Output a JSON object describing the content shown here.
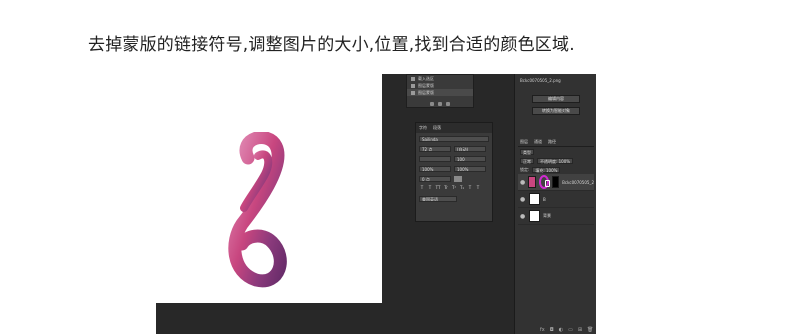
{
  "instruction": "去掉蒙版的链接符号,调整图片的大小,位置,找到合适的颜色区域.",
  "history_panel": {
    "items": [
      "载入选区",
      "图层蒙版",
      "图层蒙版"
    ]
  },
  "character_panel": {
    "tabs": [
      "字符",
      "段落"
    ],
    "font": "Sailinda",
    "size": "72 点",
    "leading": "(自动)",
    "tracking": "100",
    "scale_v": "100%",
    "scale_h": "100%",
    "baseline": "0 点",
    "style_buttons": [
      "T",
      "T",
      "TT",
      "Tr",
      "T¹",
      "T₁",
      "T",
      "T"
    ],
    "language": "美国英语"
  },
  "properties_panel": {
    "filename": "Bckc0070505_2.png",
    "button_1": "编辑内容",
    "button_2": "转换为智能对象"
  },
  "layers_panel": {
    "tabs": [
      "图层",
      "通道",
      "路径"
    ],
    "kind": "类型",
    "mode": "正常",
    "opacity": "不透明度: 100%",
    "lock": "锁定:",
    "fill": "填充: 100%",
    "layers": [
      {
        "name": "Bckc0070505_2",
        "selected": true
      },
      {
        "name": "B",
        "selected": false
      },
      {
        "name": "背景",
        "selected": false
      }
    ],
    "footer_icons": [
      "fx",
      "◘",
      "◐",
      "▭",
      "⊞",
      "🗑"
    ]
  },
  "colors": {
    "ps_dark": "#282828",
    "panel": "#3a3a3a",
    "highlight": "#d02bd0"
  }
}
